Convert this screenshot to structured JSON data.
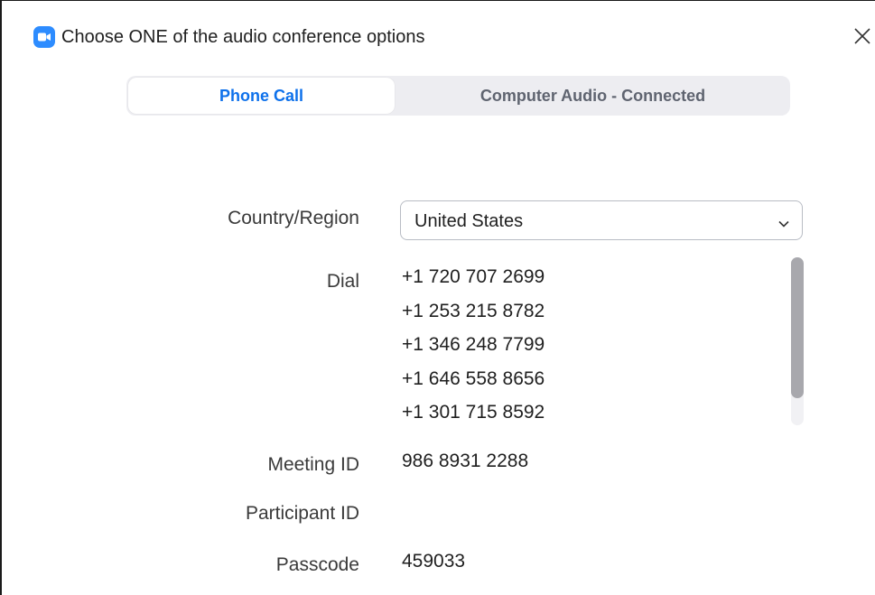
{
  "window": {
    "title": "Choose ONE of the audio conference options",
    "app_icon": "zoom-camera-icon",
    "close_icon": "close-icon"
  },
  "tabs": [
    {
      "label": "Phone Call",
      "active": true
    },
    {
      "label": "Computer Audio - Connected",
      "active": false
    }
  ],
  "form": {
    "country_label": "Country/Region",
    "country_value": "United States",
    "dial_label": "Dial",
    "dial_numbers": [
      "+1 720 707 2699",
      "+1 253 215 8782",
      "+1 346 248 7799",
      "+1 646 558 8656",
      "+1 301 715 8592"
    ],
    "meeting_id_label": "Meeting ID",
    "meeting_id_value": "986 8931 2288",
    "participant_id_label": "Participant ID",
    "participant_id_value": "",
    "passcode_label": "Passcode",
    "passcode_value": "459033"
  },
  "colors": {
    "accent": "#0e71eb",
    "zoom_blue": "#2d8cff",
    "tab_inactive_text": "#5f6470",
    "segment_bg": "#ededf1"
  }
}
